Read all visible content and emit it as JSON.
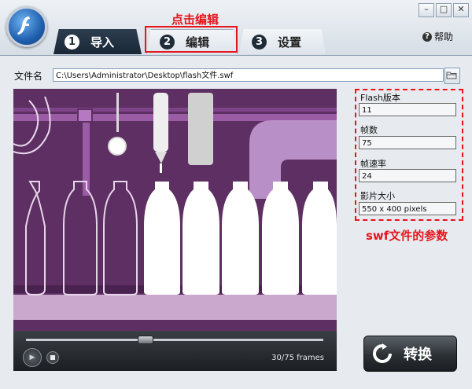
{
  "window": {
    "minimize": "–",
    "maximize": "□",
    "close": "✕"
  },
  "tabs": [
    {
      "num": "1",
      "label": "导入"
    },
    {
      "num": "2",
      "label": "编辑"
    },
    {
      "num": "3",
      "label": "设置"
    }
  ],
  "annotation": {
    "click_edit": "点击编辑",
    "params_caption": "swf文件的参数"
  },
  "help": {
    "label": "帮助",
    "icon": "?"
  },
  "file": {
    "label": "文件名",
    "path": "C:\\Users\\Administrator\\Desktop\\flash文件.swf"
  },
  "player": {
    "frames_text": "30/75 frames",
    "progress": 0.4,
    "play_icon": "▶"
  },
  "params": {
    "flash_version_label": "Flash版本",
    "flash_version": "11",
    "frames_label": "帧数",
    "frames": "75",
    "fps_label": "帧速率",
    "fps": "24",
    "size_label": "影片大小",
    "size": "550 x 400 pixels"
  },
  "convert": {
    "label": "转换"
  },
  "colors": {
    "annotation": "#e5151d",
    "tab_active": "#1a2836",
    "preview_bg": "#5e2f62"
  }
}
